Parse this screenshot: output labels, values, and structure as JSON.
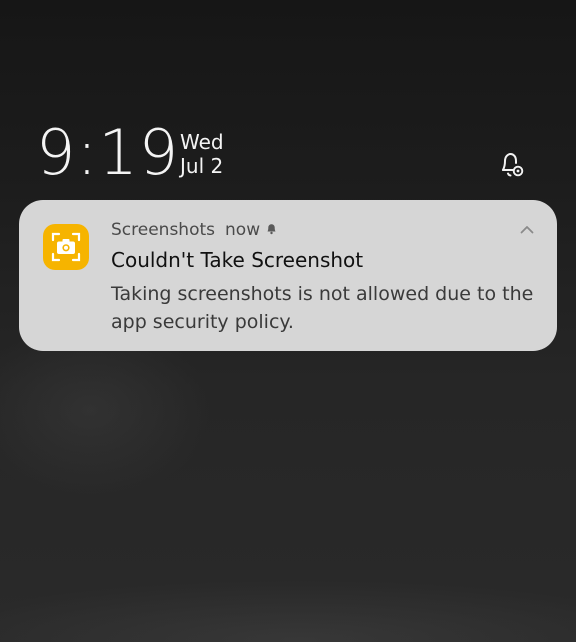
{
  "lockscreen": {
    "time": "9:19",
    "day": "Wed",
    "date": "Jul 2",
    "alerts_icon": "bell-settings-icon"
  },
  "notification": {
    "app_icon": "camera-screenshot-icon",
    "app_name": "Screenshots",
    "time_ago": "now",
    "silent_icon": "bell-icon",
    "expand_icon": "chevron-up-icon",
    "title": "Couldn't Take Screenshot",
    "body": "Taking screenshots is not allowed due to the app security policy.",
    "colors": {
      "card": "#d6d6d6",
      "app_icon": "#f6b400"
    }
  }
}
